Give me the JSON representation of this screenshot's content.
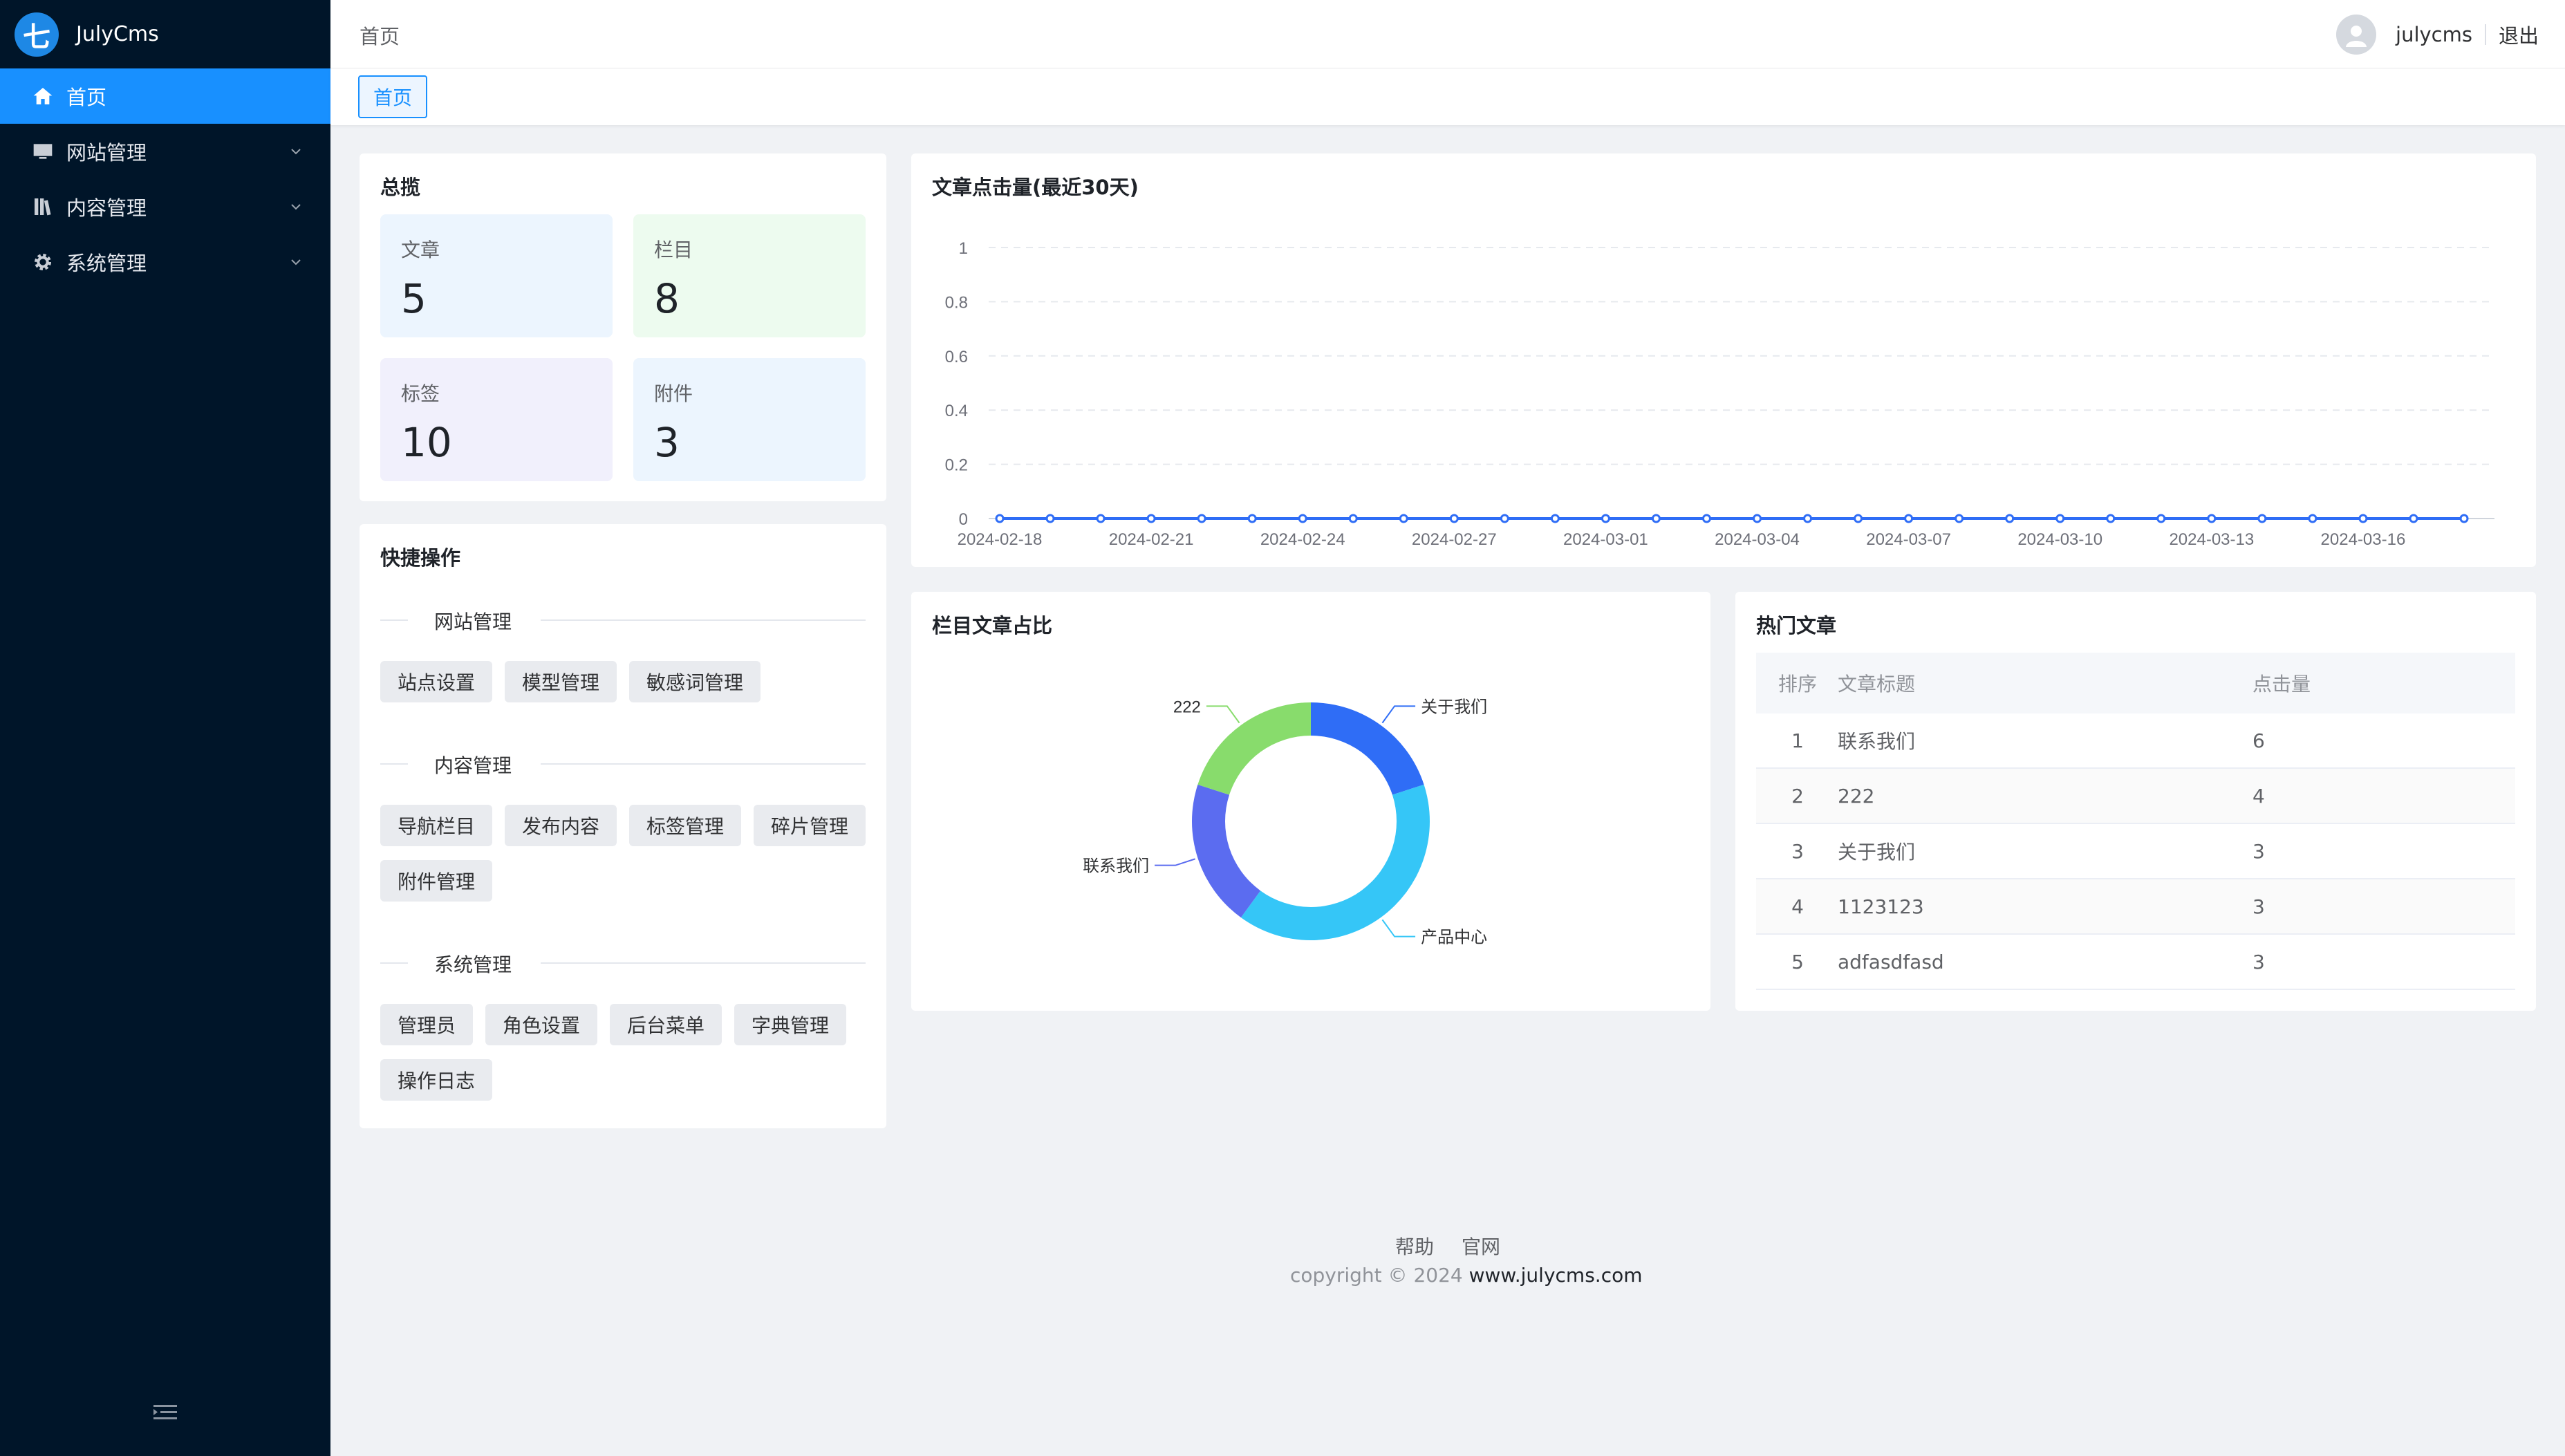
{
  "app": {
    "logo_char": "七",
    "name": "JulyCms"
  },
  "sidebar": {
    "items": [
      {
        "label": "首页",
        "icon": "home-icon",
        "active": true
      },
      {
        "label": "网站管理",
        "icon": "monitor-icon"
      },
      {
        "label": "内容管理",
        "icon": "books-icon"
      },
      {
        "label": "系统管理",
        "icon": "gear-icon"
      }
    ]
  },
  "header": {
    "breadcrumb": "首页",
    "username": "julycms",
    "logout": "退出"
  },
  "tabs": [
    {
      "label": "首页"
    }
  ],
  "overview": {
    "title": "总揽",
    "stats": [
      {
        "label": "文章",
        "value": "5",
        "bg": "#ecf5fe"
      },
      {
        "label": "栏目",
        "value": "8",
        "bg": "#edfbef"
      },
      {
        "label": "标签",
        "value": "10",
        "bg": "#f1f0fc"
      },
      {
        "label": "附件",
        "value": "3",
        "bg": "#ecf5fe"
      }
    ]
  },
  "quick": {
    "title": "快捷操作",
    "sections": [
      {
        "title": "网站管理",
        "buttons": [
          "站点设置",
          "模型管理",
          "敏感词管理"
        ]
      },
      {
        "title": "内容管理",
        "buttons": [
          "导航栏目",
          "发布内容",
          "标签管理",
          "碎片管理",
          "附件管理"
        ]
      },
      {
        "title": "系统管理",
        "buttons": [
          "管理员",
          "角色设置",
          "后台菜单",
          "字典管理",
          "操作日志"
        ]
      }
    ]
  },
  "clicks_chart": {
    "title": "文章点击量(最近30天)",
    "chart_data": {
      "type": "line",
      "x": [
        "2024-02-18",
        "2024-02-19",
        "2024-02-20",
        "2024-02-21",
        "2024-02-22",
        "2024-02-23",
        "2024-02-24",
        "2024-02-25",
        "2024-02-26",
        "2024-02-27",
        "2024-02-28",
        "2024-02-29",
        "2024-03-01",
        "2024-03-02",
        "2024-03-03",
        "2024-03-04",
        "2024-03-05",
        "2024-03-06",
        "2024-03-07",
        "2024-03-08",
        "2024-03-09",
        "2024-03-10",
        "2024-03-11",
        "2024-03-12",
        "2024-03-13",
        "2024-03-14",
        "2024-03-15",
        "2024-03-16",
        "2024-03-17",
        "2024-03-18"
      ],
      "x_tick_labels": [
        "2024-02-18",
        "2024-02-21",
        "2024-02-24",
        "2024-02-27",
        "2024-03-01",
        "2024-03-04",
        "2024-03-07",
        "2024-03-10",
        "2024-03-13",
        "2024-03-16"
      ],
      "series": [
        {
          "values": [
            0,
            0,
            0,
            0,
            0,
            0,
            0,
            0,
            0,
            0,
            0,
            0,
            0,
            0,
            0,
            0,
            0,
            0,
            0,
            0,
            0,
            0,
            0,
            0,
            0,
            0,
            0,
            0,
            0,
            0
          ],
          "color": "#2f6df6"
        }
      ],
      "ylim": [
        0,
        1
      ],
      "y_ticks": [
        "0",
        "0.2",
        "0.4",
        "0.6",
        "0.8",
        "1"
      ],
      "grid": true
    }
  },
  "category_chart": {
    "title": "栏目文章占比",
    "chart_data": {
      "type": "pie",
      "donut": true,
      "slices": [
        {
          "label": "关于我们",
          "value": 1,
          "color": "#2f6df6"
        },
        {
          "label": "产品中心",
          "value": 2,
          "color": "#35c6f7"
        },
        {
          "label": "联系我们",
          "value": 1,
          "color": "#5b6cf0"
        },
        {
          "label": "222",
          "value": 1,
          "color": "#88dc6c"
        }
      ]
    }
  },
  "hot": {
    "title": "热门文章",
    "columns": [
      "排序",
      "文章标题",
      "点击量"
    ],
    "rows": [
      {
        "rank": "1",
        "title": "联系我们",
        "clicks": "6"
      },
      {
        "rank": "2",
        "title": "222",
        "clicks": "4"
      },
      {
        "rank": "3",
        "title": "关于我们",
        "clicks": "3"
      },
      {
        "rank": "4",
        "title": "1123123",
        "clicks": "3"
      },
      {
        "rank": "5",
        "title": "adfasdfasd",
        "clicks": "3"
      }
    ]
  },
  "footer": {
    "links": [
      "帮助",
      "官网"
    ],
    "copyright": "copyright © 2024",
    "site": "www.julycms.com"
  }
}
